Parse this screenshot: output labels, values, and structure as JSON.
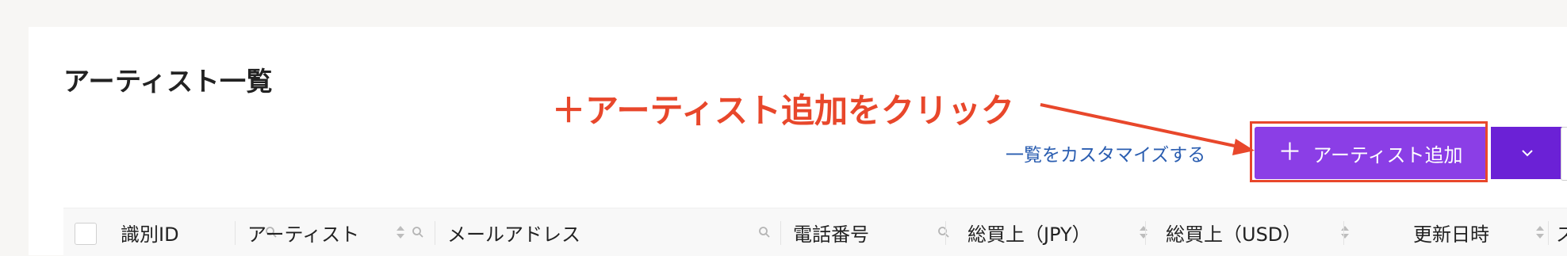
{
  "page": {
    "title": "アーティスト一覧"
  },
  "toolbar": {
    "customize_label": "一覧をカスタマイズする",
    "add_button_label": "アーティスト追加",
    "add_button_icon": "plus-icon",
    "dropdown_icon": "chevron-down-icon"
  },
  "annotation": {
    "text": "＋アーティスト追加をクリック",
    "color": "#e8472b"
  },
  "colors": {
    "accent": "#8b3ee6",
    "accent_dark": "#6b21d6",
    "link": "#2a5db0"
  },
  "table": {
    "columns": [
      {
        "label": "識別ID",
        "sortable": false,
        "searchable": true
      },
      {
        "label": "アーティスト",
        "sortable": true,
        "searchable": true
      },
      {
        "label": "メールアドレス",
        "sortable": false,
        "searchable": true
      },
      {
        "label": "電話番号",
        "sortable": false,
        "searchable": true
      },
      {
        "label": "総買上（JPY）",
        "sortable": true,
        "searchable": false
      },
      {
        "label": "総買上（USD）",
        "sortable": true,
        "searchable": false
      },
      {
        "label": "更新日時",
        "sortable": true,
        "searchable": false
      },
      {
        "label": "ス",
        "sortable": false,
        "searchable": false
      }
    ]
  }
}
